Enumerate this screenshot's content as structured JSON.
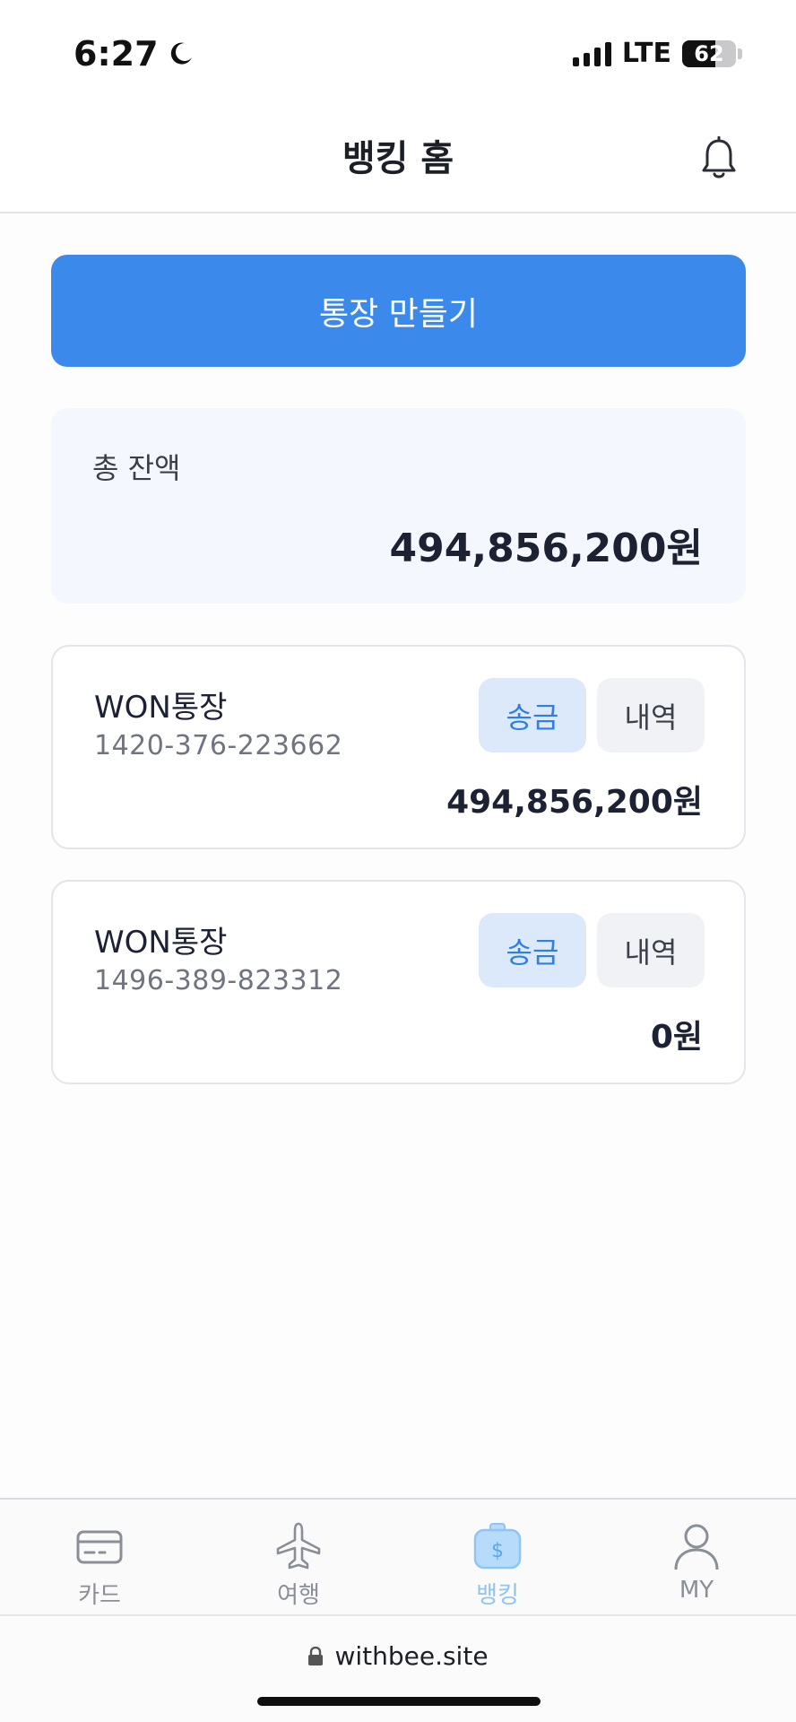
{
  "status_bar": {
    "time": "6:27",
    "network": "LTE",
    "battery": "62",
    "battery_level_percent": 62
  },
  "header": {
    "title": "뱅킹 홈",
    "icon": "bell-icon"
  },
  "create_account_button": "통장 만들기",
  "total_balance": {
    "label": "총 잔액",
    "amount": "494,856,200원"
  },
  "accounts": [
    {
      "name": "WON통장",
      "number": "1420-376-223662",
      "transfer_label": "송금",
      "history_label": "내역",
      "balance": "494,856,200원"
    },
    {
      "name": "WON통장",
      "number": "1496-389-823312",
      "transfer_label": "송금",
      "history_label": "내역",
      "balance": "0원"
    }
  ],
  "bottom_nav": {
    "items": [
      {
        "label": "카드",
        "icon": "card-icon",
        "active": false
      },
      {
        "label": "여행",
        "icon": "airplane-icon",
        "active": false
      },
      {
        "label": "뱅킹",
        "icon": "money-bag-icon",
        "active": true
      },
      {
        "label": "MY",
        "icon": "person-icon",
        "active": false
      }
    ]
  },
  "browser": {
    "url": "withbee.site"
  },
  "colors": {
    "primary": "#3b89ea",
    "transfer_bg": "#dce9fb",
    "active_nav": "#8fc4f5"
  }
}
